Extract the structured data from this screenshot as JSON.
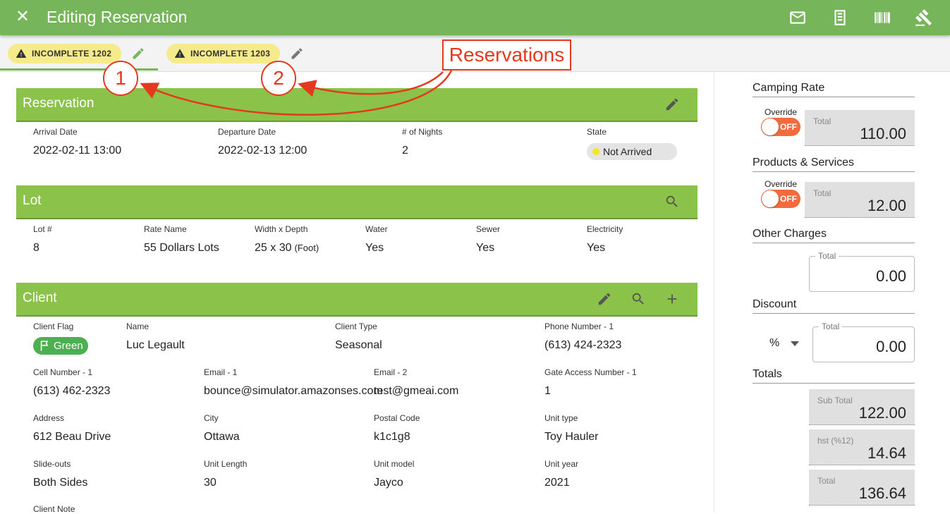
{
  "header": {
    "close_icon": "close-icon",
    "title": "Editing Reservation",
    "icons": [
      "mail-icon",
      "document-icon",
      "barcode-icon",
      "gavel-icon"
    ]
  },
  "tabs": [
    {
      "label": "INCOMPLETE 1202",
      "icon": "warning-icon",
      "active": true
    },
    {
      "label": "INCOMPLETE 1203",
      "icon": "warning-icon",
      "active": false
    }
  ],
  "annotation": {
    "label": "Reservations",
    "markers": [
      "1",
      "2"
    ],
    "color": "#e4391d"
  },
  "reservation": {
    "title": "Reservation",
    "fields": [
      {
        "label": "Arrival Date",
        "value": "2022-02-11 13:00"
      },
      {
        "label": "Departure Date",
        "value": "2022-02-13 12:00"
      },
      {
        "label": "# of Nights",
        "value": "2"
      },
      {
        "label": "State",
        "value": "Not Arrived"
      }
    ]
  },
  "lot": {
    "title": "Lot",
    "fields": [
      {
        "label": "Lot #",
        "value": "8"
      },
      {
        "label": "Rate Name",
        "value": "55 Dollars Lots"
      },
      {
        "label": "Width x Depth",
        "value": "25 x 30",
        "unit": "(Foot)"
      },
      {
        "label": "Water",
        "value": "Yes"
      },
      {
        "label": "Sewer",
        "value": "Yes"
      },
      {
        "label": "Electricity",
        "value": "Yes"
      }
    ]
  },
  "client": {
    "title": "Client",
    "flag": {
      "label": "Client Flag",
      "value": "Green",
      "color": "#4caf50"
    },
    "fields": [
      {
        "label": "Name",
        "value": "Luc Legault"
      },
      {
        "label": "Client Type",
        "value": "Seasonal"
      },
      {
        "label": "Phone Number - 1",
        "value": "(613) 424-2323"
      },
      {
        "label": "Cell Number - 1",
        "value": "(613) 462-2323"
      },
      {
        "label": "Email - 1",
        "value": "bounce@simulator.amazonses.com"
      },
      {
        "label": "Email - 2",
        "value": "test@gmeai.com"
      },
      {
        "label": "Gate Access Number - 1",
        "value": "1"
      },
      {
        "label": "Address",
        "value": "612 Beau Drive"
      },
      {
        "label": "City",
        "value": "Ottawa"
      },
      {
        "label": "Postal Code",
        "value": "k1c1g8"
      },
      {
        "label": "Unit type",
        "value": "Toy Hauler"
      },
      {
        "label": "Slide-outs",
        "value": "Both Sides"
      },
      {
        "label": "Unit Length",
        "value": "30"
      },
      {
        "label": "Unit model",
        "value": "Jayco"
      },
      {
        "label": "Unit year",
        "value": "2021"
      },
      {
        "label": "Client Note",
        "value": ""
      }
    ]
  },
  "sidebar": {
    "camping_rate": {
      "title": "Camping Rate",
      "override_label": "Override",
      "toggle": "OFF",
      "total_label": "Total",
      "total": "110.00"
    },
    "products": {
      "title": "Products & Services",
      "override_label": "Override",
      "toggle": "OFF",
      "total_label": "Total",
      "total": "12.00"
    },
    "other_charges": {
      "title": "Other Charges",
      "total_label": "Total",
      "total": "0.00"
    },
    "discount": {
      "title": "Discount",
      "type": "%",
      "total_label": "Total",
      "total": "0.00"
    },
    "totals": {
      "title": "Totals",
      "rows": [
        {
          "label": "Sub Total",
          "value": "122.00"
        },
        {
          "label": "hst (%12)",
          "value": "14.64"
        },
        {
          "label": "Total",
          "value": "136.64"
        }
      ]
    }
  },
  "colors": {
    "header": "#77b55a",
    "card_header": "#8bc34a",
    "toggle_off": "#f26a3d",
    "chip_warning": "#f5ea8c"
  }
}
